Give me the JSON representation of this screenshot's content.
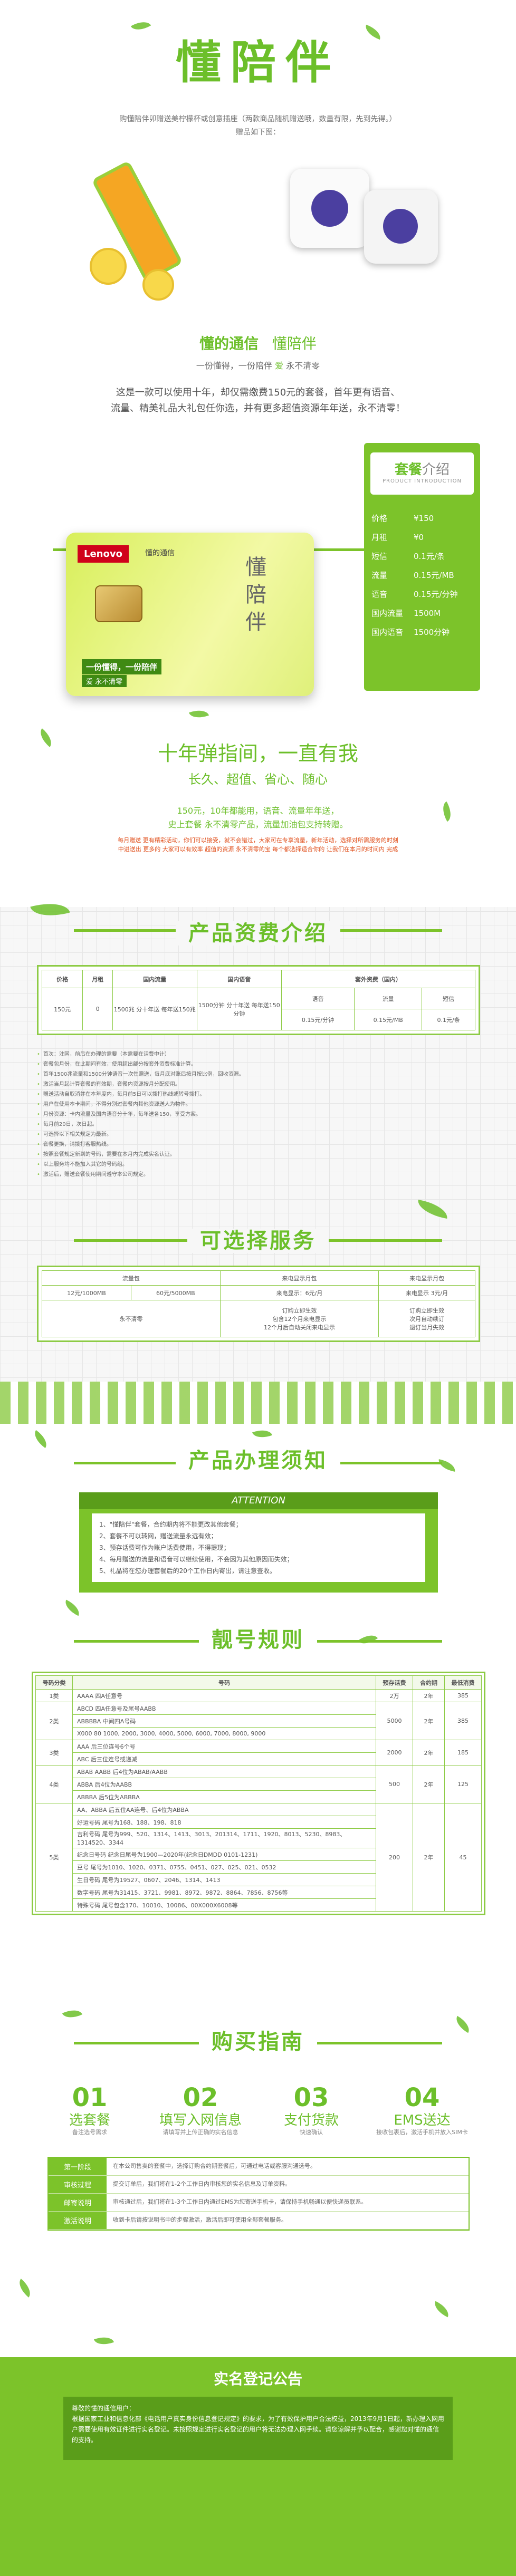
{
  "header": {
    "title": "懂陪伴",
    "intro": "购懂陪伴卯赠送美柠檬杯或创意插座（两款商品随机赠送哦，数量有限，先到先得。）",
    "intro2": "赠品如下图："
  },
  "brand": {
    "title_a": "懂的通信",
    "title_b": "懂陪伴",
    "slogan_a": "一份懂得，一份陪伴",
    "slogan_heart": "爱",
    "slogan_b": "永不清零",
    "desc1": "这是一款可以使用十年，却仅需缴费150元的套餐，首年更有语音、",
    "desc2": "流量、精美礼品大礼包任你选，并有更多超值资源年年送，永不清零！"
  },
  "card": {
    "logo": "Lenovo",
    "brand": "懂的通信",
    "calligraphy": "懂陪伴",
    "tagline1": "一份懂得，一份陪伴",
    "tagline2": "爱 永不清零"
  },
  "package": {
    "title": "套餐",
    "title2": "介绍",
    "subtitle": "PRODUCT INTRODUCTION",
    "rows": [
      [
        "价格",
        "¥150"
      ],
      [
        "月租",
        "¥0"
      ],
      [
        "短信",
        "0.1元/条"
      ],
      [
        "流量",
        "0.15元/MB"
      ],
      [
        "语音",
        "0.15元/分钟"
      ],
      [
        "国内流量",
        "1500M"
      ],
      [
        "国内语音",
        "1500分钟"
      ]
    ]
  },
  "slogan": {
    "title": "十年弹指间，一直有我",
    "sub": "长久、超值、省心、随心",
    "l1": "150元，10年都能用，语音、流量年年送，",
    "l2": "史上套餐 永不清零产品，流量加油包支持转赠。",
    "l3": "每月赠送 更有精彩活动，你们可以接受，就不会错过，大家可在专享流量，新年活动，选择对所需服务的时刻",
    "l4": "中进送出 更多的 大家可以有效率 超值的资源 永不清零的宝 每个都选择适合你的 让我们在本月的时间内 完成"
  },
  "fees": {
    "title": "产品资费介绍",
    "headers": [
      "价格",
      "月租",
      "国内流量",
      "国内语音",
      "套外资费（国内）"
    ],
    "sub_headers": [
      "语音",
      "流量",
      "短信"
    ],
    "row": [
      "150元",
      "0",
      "1500兆 分十年送 每年送150兆",
      "1500分钟 分十年送 每年送150分钟",
      "0.15元/分钟",
      "0.15元/MB",
      "0.1元/条"
    ]
  },
  "notes": [
    "首次：注网，前后在办理的需要（本需要在话费中计）",
    "套餐包月份，在此期间有效，使用超出部分按套外资费标准计算。",
    "首年1500兆流量和1500分钟语音一次性赠送，每月底对账后按月按比例，回收资源。",
    "激活当月起计算套餐的有效期，套餐内资源按月分配使用。",
    "赠送活动自取消并在本年度内，每月前5日可以拨打热线或转号拨打。",
    "用户在使用本卡期间，不得分别过套餐内其他资源送人为物件。",
    "月份资源：卡内流量及国内语音分十年，每年送各150，享受方案。",
    "每月前20日，次日起。",
    "可选择以下相关规定为最新。",
    "套餐更换，请拨打客服热线。",
    "按照套餐规定新到的号码，需要在本月内完成实名认证。",
    "以上服务均不能加入其它的号码组。",
    "激活后，赠送套餐使用期间遵守本公司规定。"
  ],
  "services": {
    "title": "可选择服务",
    "col1": "流量包",
    "col2": "来电显示月包",
    "col3": "来电显示月包",
    "opts": [
      "12元/1000MB",
      "60元/5000MB"
    ],
    "none": "永不清零",
    "c2a": "订购立即生效",
    "c2b": "包含12个月来电显示",
    "c2c": "12个月后自动关闭来电显示",
    "c3a": "订购立即生效",
    "c3b": "次月自动续订",
    "c3c": "退订当月失效",
    "price2": "来电显示：6元/月",
    "price3": "来电显示 3元/月"
  },
  "notice": {
    "title": "产品办理须知",
    "banner": "ATTENTION",
    "items": [
      "1、\"懂陪伴\"套餐，合约期内将不能更改其他套餐；",
      "2、套餐不可以转网，赠送流量永远有效；",
      "3、预存话费可作为账户话费使用，不得提现；",
      "4、每月赠送的流量和语音可以继续使用，不会因为其他原因而失效；",
      "5、礼品将在您办理套餐后的20个工作日内寄出，请注意查收。"
    ]
  },
  "numbers": {
    "title": "靓号规则",
    "headers": [
      "号码分类",
      "号码",
      "预存话费",
      "合约期",
      "最低消费"
    ],
    "rows": [
      {
        "cat": "1类",
        "items": [
          "AAAA    四A任意号"
        ],
        "fee": "2万",
        "term": "2年",
        "min": "385"
      },
      {
        "cat": "2类",
        "items": [
          "ABCD    四A任意号及尾号AABB",
          "ABBBBA    中间四A号码",
          "X000    80 1000, 2000, 3000, 4000, 5000, 6000, 7000, 8000, 9000"
        ],
        "fee": "5000",
        "term": "2年",
        "min": "385"
      },
      {
        "cat": "3类",
        "items": [
          "AAA    后三位连号6个号",
          "ABC    后三位连号或递减"
        ],
        "fee": "2000",
        "term": "2年",
        "min": "185"
      },
      {
        "cat": "4类",
        "items": [
          "ABAB  AABB  后4位为ABAB/AABB",
          "ABBA  后4位为AABB",
          "ABBBA  后5位为ABBBA"
        ],
        "fee": "500",
        "term": "2年",
        "min": "125"
      },
      {
        "cat": "5类",
        "items": [
          "AA、ABBA  后五位AA连号、后4位为ABBA",
          "好运号码  尾号为168、188、198、818",
          "吉利号码  尾号为999、520、1314、1413、3013、201314、1711、1920、8013、5230、8983、1314520、3344",
          "纪念日号码  纪念日尾号为1900—2020年(纪念日DMDD 0101-1231)",
          "豆号  尾号为1010、1020、0371、0755、0451、027、025、021、0532",
          "生日号码  尾号为19527、0607、2046、1314、1413",
          "数字号码  尾号为31415、3721、9981、8972、9872、8864、7856、8756等",
          "特殊号码  尾号包含170、10010、10086、00X000X6008等"
        ],
        "fee": "200",
        "term": "2年",
        "min": "45"
      }
    ]
  },
  "guide": {
    "title": "购买指南",
    "steps": [
      {
        "num": "01",
        "t": "选套餐",
        "d": "备注选号需求"
      },
      {
        "num": "02",
        "t": "填写入网信息",
        "d": "请填写并上传正确的实名信息"
      },
      {
        "num": "03",
        "t": "支付货款",
        "d": "快速确认"
      },
      {
        "num": "04",
        "t": "EMS送达",
        "d": "接收包裹后，激活手机并放入SIM卡"
      }
    ],
    "rows": [
      {
        "k": "第一阶段",
        "v": "在本公司售卖的套餐中，选择订购合约期套餐后，可通过电话或客服沟通选号。"
      },
      {
        "k": "审核过程",
        "v": "提交订单后，我们将在1-2个工作日内审核您的实名信息及订单资料。"
      },
      {
        "k": "邮寄说明",
        "v": "审核通过后，我们将在1-3个工作日内通过EMS为您寄送手机卡，请保持手机畅通以便快递员联系。"
      },
      {
        "k": "激活说明",
        "v": "收到卡后请按说明书中的步骤激活，激活后即可使用全部套餐服务。"
      }
    ]
  },
  "realname": {
    "title": "实名登记公告",
    "lead": "尊敬的懂的通信用户：",
    "body": "根据国家工业和信息化部《电话用户真实身份信息登记规定》的要求，为了有效保护用户合法权益，2013年9月1日起，新办理入网用户需要使用有效证件进行实名登记。未按照规定进行实名登记的用户将无法办理入网手续。请您谅解并予以配合，感谢您对懂的通信的支持。"
  }
}
